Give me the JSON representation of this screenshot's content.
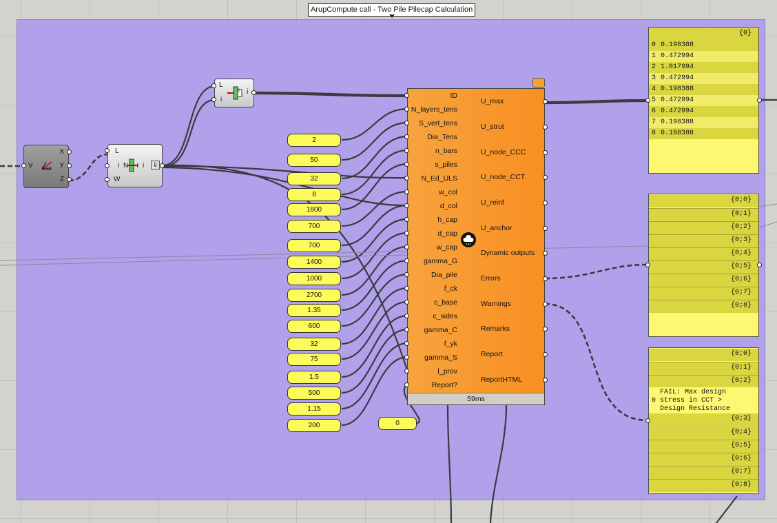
{
  "group": {
    "title": "ArupCompute call - Two Pile Pilecap Calculation"
  },
  "xyz_component": {
    "input": "V",
    "outputs": [
      "X",
      "Y",
      "Z"
    ],
    "icon_label": "XYZ"
  },
  "list_item_component": {
    "inputs": [
      "L",
      "i",
      "W"
    ],
    "icon_letter": "N",
    "output": "i"
  },
  "top_item_component": {
    "inputs": [
      "L",
      "i"
    ],
    "icon_letter": "i",
    "output": "i"
  },
  "sliders": [
    "2",
    "50",
    "32",
    "8",
    "1800",
    "700",
    "700",
    "1400",
    "1000",
    "2700",
    "1.35",
    "600",
    "32",
    "75",
    "1.5",
    "500",
    "1.15",
    "200"
  ],
  "report_toggle": "0",
  "main_component": {
    "inputs": [
      "ID",
      "N_layers_tens",
      "S_vert_tens",
      "Dia_Tens",
      "n_bars",
      "s_piles",
      "N_Ed_ULS",
      "w_col",
      "d_col",
      "h_cap",
      "d_cap",
      "w_cap",
      "gamma_G",
      "Dia_pile",
      "f_ck",
      "c_base",
      "c_sides",
      "gamma_C",
      "f_yk",
      "gamma_S",
      "l_prov",
      "Report?"
    ],
    "outputs": [
      "U_max",
      "U_strut",
      "U_node_CCC",
      "U_node_CCT",
      "U_reinf",
      "U_anchor",
      "Dynamic outputs",
      "Errors",
      "Warnings",
      "Remarks",
      "Report",
      "ReportHTML"
    ],
    "timing": "59ms",
    "icon": "cloud-icon"
  },
  "panel_umax": {
    "header": "{0}",
    "rows": [
      {
        "index": "0",
        "value": "0.198388"
      },
      {
        "index": "1",
        "value": "0.472994"
      },
      {
        "index": "2",
        "value": "1.017994"
      },
      {
        "index": "3",
        "value": "0.472994"
      },
      {
        "index": "4",
        "value": "0.198388"
      },
      {
        "index": "5",
        "value": "0.472994"
      },
      {
        "index": "6",
        "value": "0.472994"
      },
      {
        "index": "7",
        "value": "0.198388"
      },
      {
        "index": "8",
        "value": "0.198388"
      }
    ]
  },
  "panel_errors": {
    "tags": [
      "{0;0}",
      "{0;1}",
      "{0;2}",
      "{0;3}",
      "{0;4}",
      "{0;5}",
      "{0;6}",
      "{0;7}",
      "{0;8}"
    ]
  },
  "panel_warnings": {
    "tags_before": [
      "{0;0}",
      "{0;1}",
      "{0;2}"
    ],
    "fail_index": "0",
    "fail_lines": [
      "FAIL: Max design",
      "stress in CCT >",
      "Design Resistance"
    ],
    "tags_after": [
      "{0;3}",
      "{0;4}",
      "{0;5}",
      "{0;6}",
      "{0;7}",
      "{0;8}"
    ]
  }
}
